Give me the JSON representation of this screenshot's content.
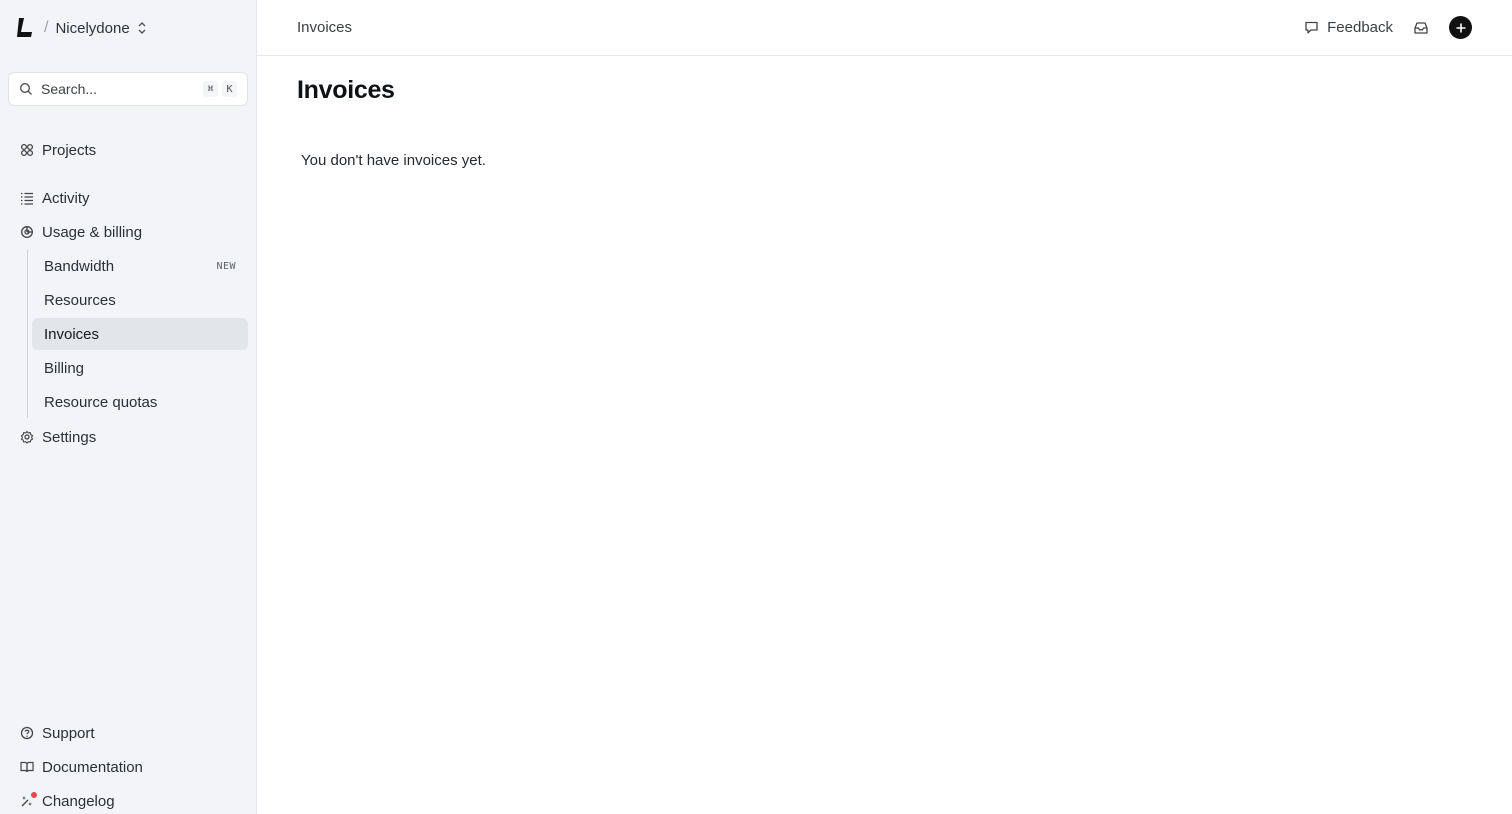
{
  "org": {
    "name": "Nicelydone"
  },
  "search": {
    "placeholder": "Search...",
    "shortcut_keys": [
      "⌘",
      "K"
    ]
  },
  "sidebar": {
    "items": [
      {
        "label": "Projects",
        "icon": "grid-icon"
      },
      {
        "label": "Activity",
        "icon": "list-icon"
      },
      {
        "label": "Usage & billing",
        "icon": "pie-chart-icon"
      },
      {
        "label": "Settings",
        "icon": "gear-icon"
      }
    ],
    "billing_sub_items": [
      {
        "label": "Bandwidth",
        "badge": "NEW"
      },
      {
        "label": "Resources"
      },
      {
        "label": "Invoices",
        "active": true
      },
      {
        "label": "Billing"
      },
      {
        "label": "Resource quotas"
      }
    ],
    "footer_items": [
      {
        "label": "Support",
        "icon": "help-circle-icon"
      },
      {
        "label": "Documentation",
        "icon": "book-icon"
      },
      {
        "label": "Changelog",
        "icon": "sparkle-icon"
      }
    ]
  },
  "topbar": {
    "breadcrumb": "Invoices",
    "feedback_label": "Feedback"
  },
  "main": {
    "title": "Invoices",
    "empty_message": "You don't have invoices yet."
  },
  "colors": {
    "sidebar_bg": "#f2f4f8",
    "active_item_bg": "#e2e5ea",
    "notification_dot": "#e5484d"
  }
}
